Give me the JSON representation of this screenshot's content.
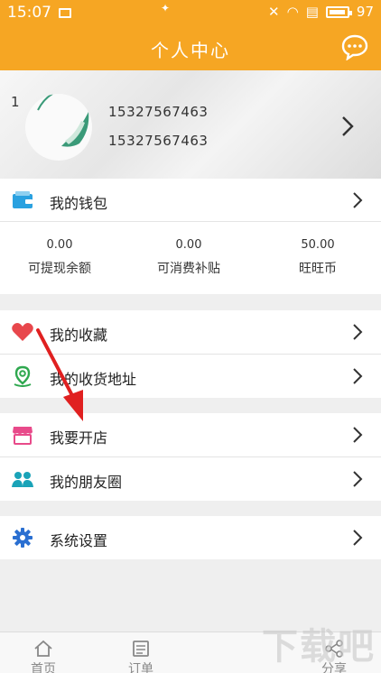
{
  "status_bar": {
    "time": "15:07",
    "battery": "97"
  },
  "header": {
    "title": "个人中心"
  },
  "profile": {
    "avatar_label": "1",
    "phone_1": "15327567463",
    "phone_2": "15327567463"
  },
  "wallet": {
    "label": "我的钱包",
    "stats": [
      {
        "value": "0.00",
        "label": "可提现余额"
      },
      {
        "value": "0.00",
        "label": "可消费补贴"
      },
      {
        "value": "50.00",
        "label": "旺旺币"
      }
    ]
  },
  "menu_group_1": [
    {
      "label": "我的收藏",
      "icon": "heart-icon"
    },
    {
      "label": "我的收货地址",
      "icon": "location-pin-icon"
    }
  ],
  "menu_group_2": [
    {
      "label": "我要开店",
      "icon": "store-icon"
    },
    {
      "label": "我的朋友圈",
      "icon": "friends-icon"
    }
  ],
  "menu_group_3": [
    {
      "label": "系统设置",
      "icon": "gear-icon"
    }
  ],
  "bottom_nav": [
    {
      "label": "首页",
      "icon": "home-icon"
    },
    {
      "label": "订单",
      "icon": "order-icon"
    },
    {
      "label": "分享",
      "icon": "share-icon"
    }
  ],
  "watermark": "下载吧",
  "colors": {
    "accent": "#f6a623",
    "heart": "#e8474c",
    "pin": "#2fa84f",
    "store": "#e84a8a",
    "friends": "#1aa3b8",
    "gear": "#2a6fd1",
    "wallet": "#2aa1e0",
    "annotation": "#e02020"
  }
}
